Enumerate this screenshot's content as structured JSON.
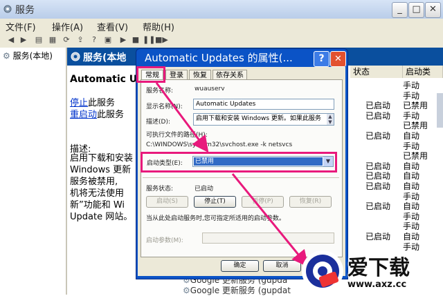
{
  "window": {
    "title": "服务",
    "min": "_",
    "max": "□",
    "close": "✕"
  },
  "menu": [
    "文件(F)",
    "操作(A)",
    "查看(V)",
    "帮助(H)"
  ],
  "tree": {
    "label": "服务(本地)"
  },
  "banner": {
    "title": "服务(本地"
  },
  "detail": {
    "service_name": "Automatic U",
    "stop_link": "停止",
    "stop_suffix": "此服务",
    "restart_link": "重启动",
    "restart_suffix": "此服务",
    "desc_label": "描述:",
    "desc_lines": [
      "启用下载和安装",
      "Windows 更新",
      "服务被禁用,",
      "机将无法使用",
      "新”功能和 Wi",
      "Update 网站。"
    ]
  },
  "list": {
    "columns": [
      "状态",
      "启动类"
    ],
    "rows": [
      [
        "",
        "手动"
      ],
      [
        "",
        "手动"
      ],
      [
        "已启动",
        "已禁用"
      ],
      [
        "已启动",
        "手动"
      ],
      [
        "",
        "已禁用"
      ],
      [
        "已启动",
        "自动"
      ],
      [
        "",
        "手动"
      ],
      [
        "",
        "已禁用"
      ],
      [
        "已启动",
        "自动"
      ],
      [
        "已启动",
        "自动"
      ],
      [
        "已启动",
        "自动"
      ],
      [
        "",
        "手动"
      ],
      [
        "已启动",
        "自动"
      ],
      [
        "",
        "手动"
      ],
      [
        "",
        "手动"
      ],
      [
        "已启动",
        "自动"
      ],
      [
        "",
        "手动"
      ]
    ]
  },
  "bottom_rows": [
    "Google 更新服务 (gupda",
    "Google 更新服务 (gupdat"
  ],
  "dialog": {
    "title": "Automatic Updates 的属性(...",
    "help": "?",
    "close": "✕",
    "tabs": [
      "常规",
      "登录",
      "恢复",
      "依存关系"
    ],
    "service_name_label": "服务名称:",
    "service_name": "wuauserv",
    "display_name_label": "显示名称(N):",
    "display_name": "Automatic Updates",
    "description_label": "描述(D):",
    "description": "启用下载和安装 Windows 更新。如果此服务",
    "path_label": "可执行文件的路径(H):",
    "path": "C:\\WINDOWS\\system32\\svchost.exe -k netsvcs",
    "startup_label": "启动类型(E):",
    "startup_value": "已禁用",
    "status_label": "服务状态:",
    "status_value": "已启动",
    "btn_start": "启动(S)",
    "btn_stop": "停止(T)",
    "btn_pause": "暂停(P)",
    "btn_resume": "恢复(R)",
    "hint": "当从此处启动服务时,您可指定所适用的启动参数。",
    "params_label": "启动参数(M):",
    "ok": "确定",
    "cancel": "取消"
  },
  "watermark": {
    "brand": "爱下载",
    "url": "www.axz.cc"
  },
  "colors": {
    "highlight": "#e8197c",
    "banner": "#0a4f9e",
    "dialog_title": "#0b53c6"
  }
}
